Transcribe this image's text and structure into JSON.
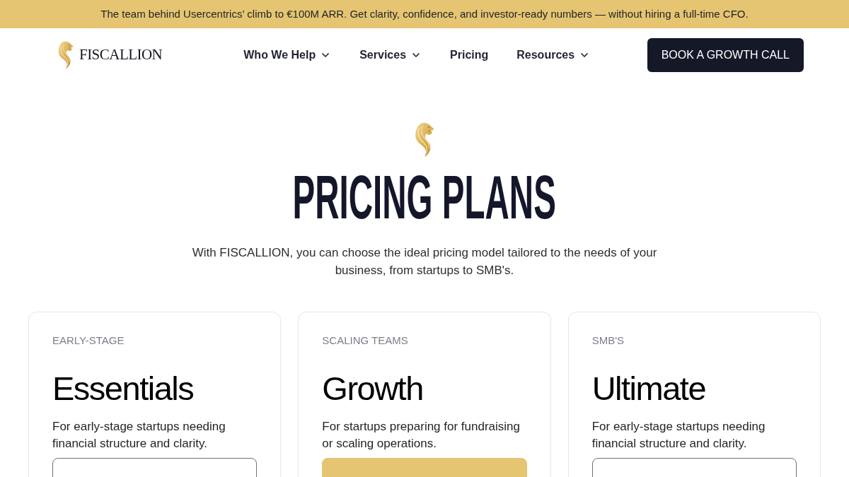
{
  "announcement": {
    "text": "The team behind Usercentrics’ climb to €100M ARR. Get clarity, confidence, and investor-ready numbers — without hiring a full-time CFO."
  },
  "header": {
    "logo": {
      "text": "FISCALLION"
    },
    "nav": [
      {
        "label": "Who We Help",
        "dropdown": true
      },
      {
        "label": "Services",
        "dropdown": true
      },
      {
        "label": "Pricing",
        "dropdown": false
      },
      {
        "label": "Resources",
        "dropdown": true
      }
    ],
    "cta": {
      "label": "BOOK A GROWTH CALL"
    }
  },
  "hero": {
    "title": "PRICING PLANS",
    "subtitle": "With FISCALLION, you can choose the ideal pricing model tailored to the needs of your business, from startups to SMB's."
  },
  "plans": [
    {
      "eyebrow": "EARLY-STAGE",
      "name": "Essentials",
      "description": "For early-stage startups needing financial structure and clarity.",
      "button": {
        "kind": "outline"
      }
    },
    {
      "eyebrow": "SCALING TEAMS",
      "name": "Growth",
      "description": "For startups preparing for fundraising or scaling operations.",
      "button": {
        "kind": "filled"
      }
    },
    {
      "eyebrow": "SMB'S",
      "name": "Ultimate",
      "description": "For early-stage startups needing financial structure and clarity.",
      "button": {
        "kind": "outline"
      }
    }
  ]
}
